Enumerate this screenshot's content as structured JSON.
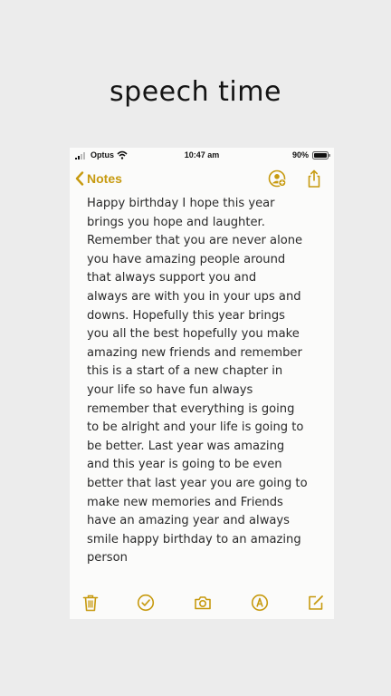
{
  "story": {
    "title": "speech time"
  },
  "status_bar": {
    "carrier": "Optus",
    "time": "10:47 am",
    "battery": "90%"
  },
  "nav": {
    "back_label": "Notes"
  },
  "note": {
    "body": "Happy birthday I hope this year\nbrings you hope and laughter.\nRemember that you are never alone\nyou have amazing people around\nthat always support  you and\nalways are with you in your ups and\ndowns. Hopefully this year brings\nyou all the best hopefully you make\namazing new friends and remember\nthis is a start of a new chapter in\nyour life so have fun always\nremember that everything is going\nto be alright and your life is going to\nbe better. Last year was amazing\nand this year is going to be even\nbetter that last year you are going to\nmake new memories and Friends\nhave an amazing year and always\nsmile happy birthday to an amazing\nperson"
  },
  "icons": {
    "accent": "#c79a0f",
    "toolbar": [
      "trash-icon",
      "checklist-icon",
      "camera-icon",
      "markup-icon",
      "compose-icon"
    ]
  }
}
